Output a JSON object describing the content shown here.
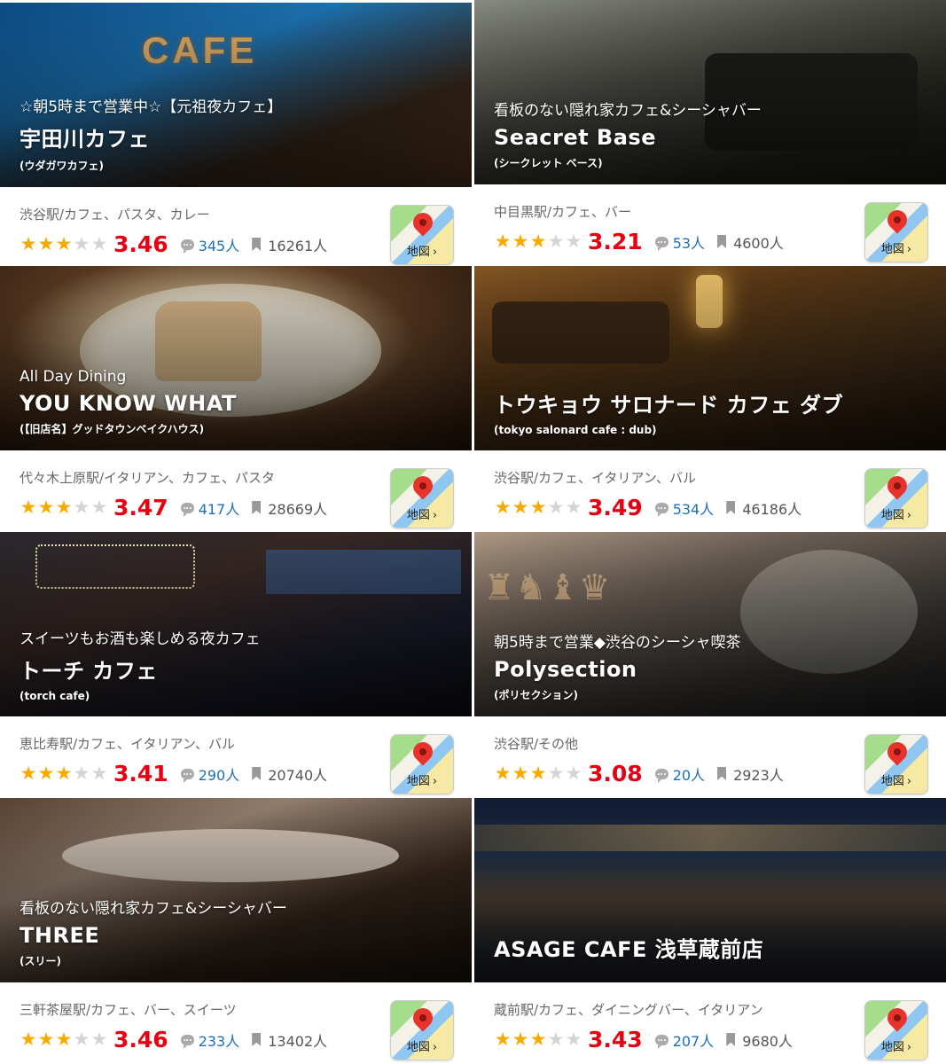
{
  "colors": {
    "star": "#f7a900",
    "score": "#e60012",
    "reviews": "#1a6fbf"
  },
  "map_label": "地図",
  "map_chevron": "›",
  "cards": [
    {
      "catch": "☆朝5時まで営業中☆【元祖夜カフェ】",
      "name": "宇田川カフェ",
      "kana": "(ウダガワカフェ)",
      "genre": "渋谷駅/カフェ、パスタ、カレー",
      "rating_stars": 3,
      "score": "3.46",
      "reviews": "345人",
      "saves": "16261人",
      "theme": "blue",
      "hero_icon": "cafe-sign"
    },
    {
      "catch": "看板のない隠れ家カフェ&シーシャバー",
      "name": "Seacret Base",
      "kana": "(シークレット ベース)",
      "genre": "中目黒駅/カフェ、バー",
      "rating_stars": 3,
      "score": "3.21",
      "reviews": "53人",
      "saves": "4600人",
      "theme": "gray",
      "hero_icon": "sofa"
    },
    {
      "catch": "All Day Dining",
      "name": "YOU KNOW WHAT",
      "kana": "(【旧店名】グッドタウンベイクハウス)",
      "genre": "代々木上原駅/イタリアン、カフェ、パスタ",
      "rating_stars": 3,
      "score": "3.47",
      "reviews": "417人",
      "saves": "28669人",
      "theme": "pudding",
      "hero_icon": "pudding"
    },
    {
      "catch": "",
      "name": "トウキョウ サロナード カフェ ダブ",
      "kana": "(tokyo salonard cafe : dub)",
      "genre": "渋谷駅/カフェ、イタリアン、バル",
      "rating_stars": 3,
      "score": "3.49",
      "reviews": "534人",
      "saves": "46186人",
      "theme": "amber",
      "hero_icon": "lounge"
    },
    {
      "catch": "スイーツもお酒も楽しめる夜カフェ",
      "name": "トーチ カフェ",
      "kana": "(torch cafe)",
      "genre": "恵比寿駅/カフェ、イタリアン、バル",
      "rating_stars": 3,
      "score": "3.41",
      "reviews": "290人",
      "saves": "20740人",
      "theme": "night",
      "hero_icon": "string-lights"
    },
    {
      "catch": "朝5時まで営業◆渋谷のシーシャ喫茶",
      "name": "Polysection",
      "kana": "(ポリセクション)",
      "genre": "渋谷駅/その他",
      "rating_stars": 3,
      "score": "3.08",
      "reviews": "20人",
      "saves": "2923人",
      "theme": "smoke",
      "hero_icon": "chess"
    },
    {
      "catch": "看板のない隠れ家カフェ&シーシャバー",
      "name": "THREE",
      "kana": "(スリー)",
      "genre": "三軒茶屋駅/カフェ、バー、スイーツ",
      "rating_stars": 3,
      "score": "3.46",
      "reviews": "233人",
      "saves": "13402人",
      "theme": "wood",
      "hero_icon": "counter"
    },
    {
      "catch": "",
      "name": "ASAGE CAFE 浅草蔵前店",
      "kana": "",
      "genre": "蔵前駅/カフェ、ダイニングバー、イタリアン",
      "rating_stars": 3,
      "score": "3.43",
      "reviews": "207人",
      "saves": "9680人",
      "theme": "river",
      "hero_icon": "river-terrace"
    }
  ]
}
